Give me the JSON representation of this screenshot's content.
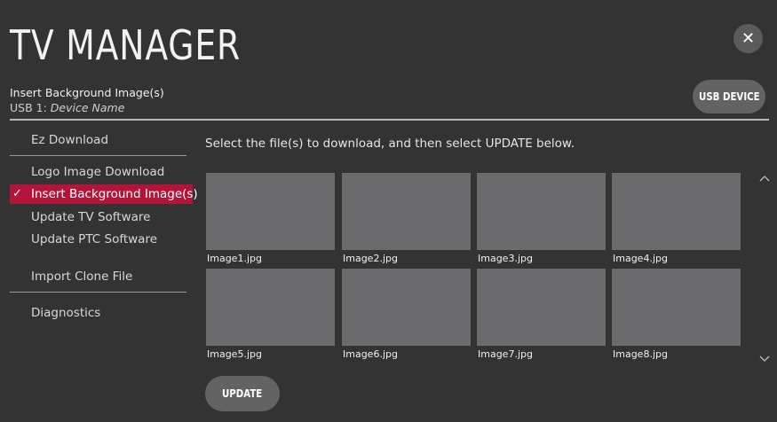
{
  "header": {
    "title": "TV MANAGER",
    "subtitle": "Insert Background Image(s)",
    "device_prefix": "USB 1:",
    "device_name": "Device Name",
    "usb_button": "USB DEVICE",
    "close_glyph": "✕"
  },
  "sidebar": {
    "items": [
      {
        "label": "Ez Download",
        "selected": false
      },
      {
        "label": "Logo Image Download",
        "selected": false
      },
      {
        "label": "Insert Background Image(s)",
        "selected": true
      },
      {
        "label": "Update TV Software",
        "selected": false
      },
      {
        "label": "Update PTC Software",
        "selected": false
      },
      {
        "label": "Import Clone File",
        "selected": false
      },
      {
        "label": "Diagnostics",
        "selected": false
      }
    ],
    "check_glyph": "✓"
  },
  "main": {
    "instruction": "Select the file(s) to download, and then select UPDATE below.",
    "images": [
      {
        "filename": "Image1.jpg"
      },
      {
        "filename": "Image2.jpg"
      },
      {
        "filename": "Image3.jpg"
      },
      {
        "filename": "Image4.jpg"
      },
      {
        "filename": "Image5.jpg"
      },
      {
        "filename": "Image6.jpg"
      },
      {
        "filename": "Image7.jpg"
      },
      {
        "filename": "Image8.jpg"
      }
    ],
    "update_button": "UPDATE",
    "scroll_up_glyph": "︿",
    "scroll_down_glyph": "﹀"
  },
  "colors": {
    "background": "#333333",
    "selected_accent": "#b5143a",
    "thumbnail": "#6b6b6d",
    "button": "#636363"
  }
}
